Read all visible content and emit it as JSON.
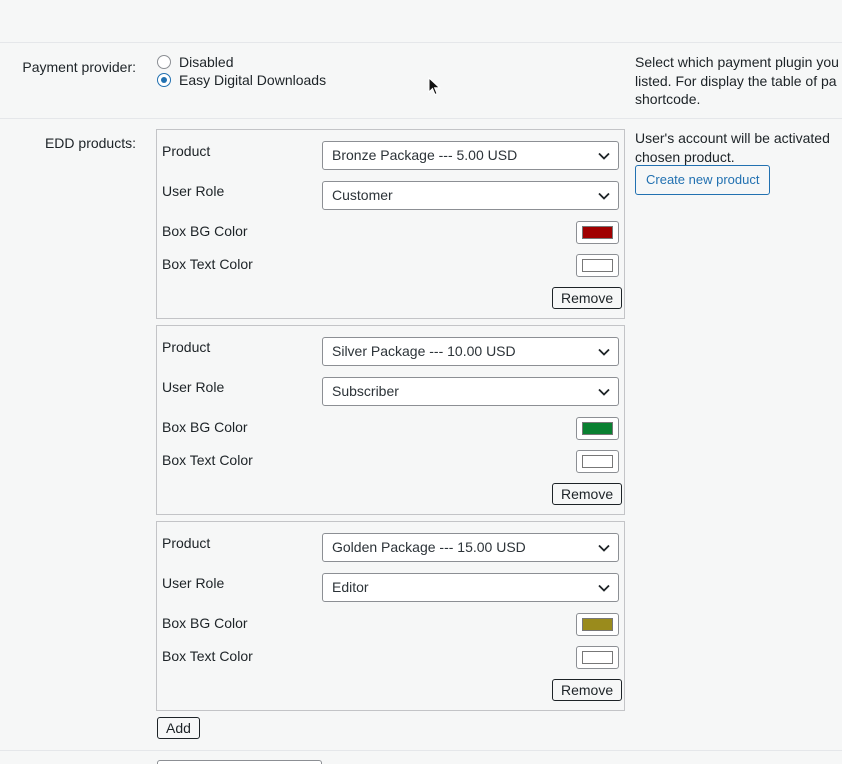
{
  "payment": {
    "label": "Payment provider:",
    "options": [
      {
        "label": "Disabled",
        "checked": false
      },
      {
        "label": "Easy Digital Downloads",
        "checked": true
      }
    ],
    "description_lines": [
      "Select which payment plugin you",
      "listed. For display the table of pa",
      "shortcode."
    ]
  },
  "edd": {
    "label": "EDD products:",
    "description_lines": [
      "User's account will be activated",
      "chosen product."
    ],
    "create_button": "Create new product",
    "add_button": "Add",
    "field_labels": {
      "product": "Product",
      "user_role": "User Role",
      "bg_color": "Box BG Color",
      "text_color": "Box Text Color"
    },
    "remove_label": "Remove",
    "products": [
      {
        "product": "Bronze Package --- 5.00 USD",
        "role": "Customer",
        "bg_color": "#a00000",
        "text_color": "#ffffff"
      },
      {
        "product": "Silver Package --- 10.00 USD",
        "role": "Subscriber",
        "bg_color": "#0a8031",
        "text_color": "#ffffff"
      },
      {
        "product": "Golden Package --- 15.00 USD",
        "role": "Editor",
        "bg_color": "#9a8b1c",
        "text_color": "#ffffff"
      }
    ]
  }
}
